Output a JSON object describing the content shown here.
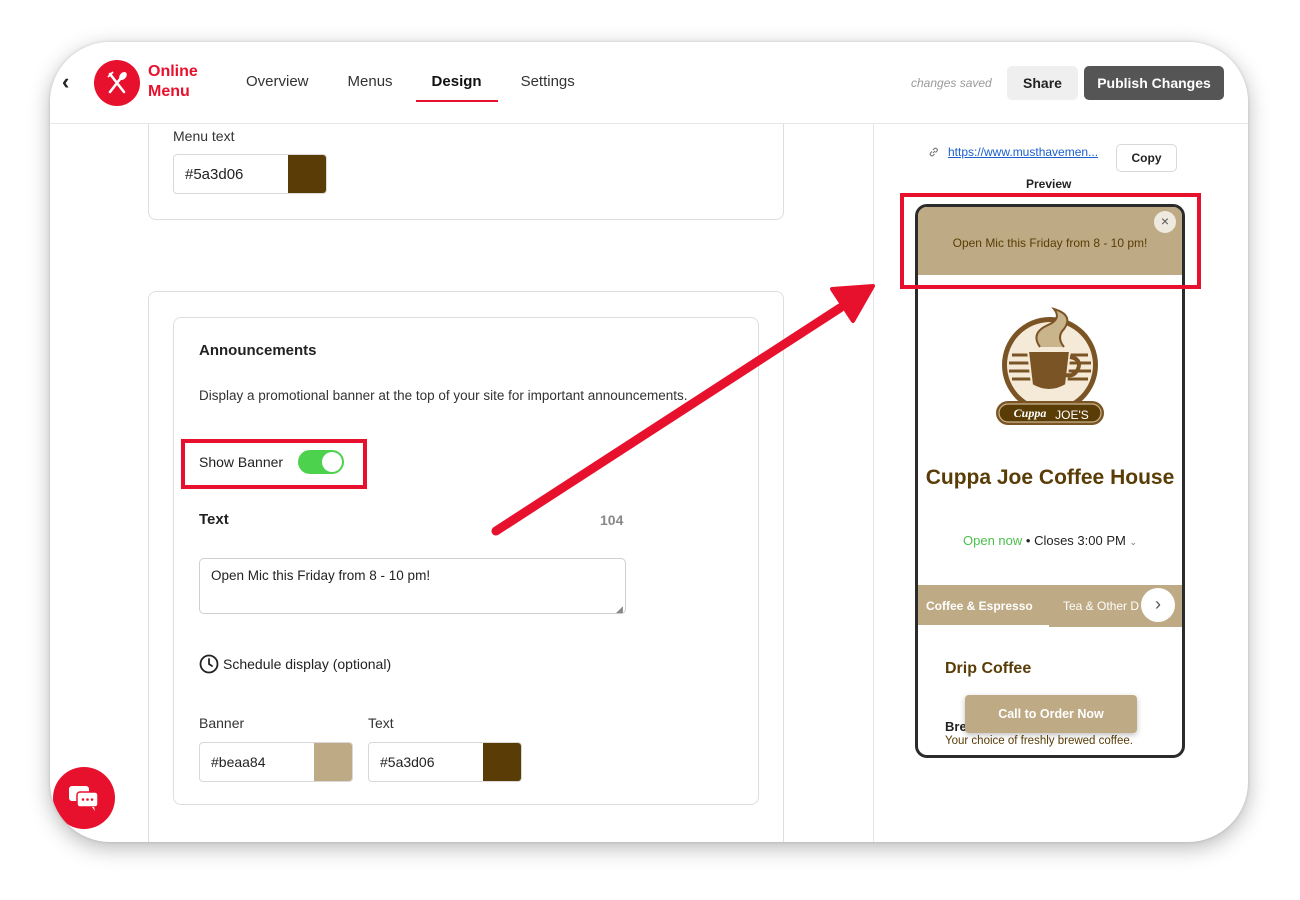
{
  "app": {
    "brand_line1": "Online",
    "brand_line2": "Menu",
    "colors": {
      "accent": "#e8112d",
      "banner": "#beaa84",
      "menu_text": "#5a3d06"
    }
  },
  "nav": {
    "items": [
      {
        "label": "Overview",
        "active": false
      },
      {
        "label": "Menus",
        "active": false
      },
      {
        "label": "Design",
        "active": true
      },
      {
        "label": "Settings",
        "active": false
      }
    ]
  },
  "header": {
    "status": "changes saved",
    "share_label": "Share",
    "publish_label": "Publish Changes"
  },
  "menu_text_section": {
    "label": "Menu text",
    "value": "#5a3d06",
    "swatch_color": "#5a3d06"
  },
  "announcements": {
    "title": "Announcements",
    "description": "Display a promotional banner at the top of your site for important announcements.",
    "show_banner_label": "Show Banner",
    "show_banner_on": true,
    "text_label": "Text",
    "char_count": "104",
    "text_value": "Open Mic this Friday from 8 - 10 pm!",
    "schedule_label": "Schedule display (optional)",
    "banner_label": "Banner",
    "banner_value": "#beaa84",
    "banner_swatch": "#beaa84",
    "text_color_label": "Text",
    "text_color_value": "#5a3d06",
    "text_color_swatch": "#5a3d06"
  },
  "preview_panel": {
    "url": "https://www.musthavemen...",
    "copy_label": "Copy",
    "preview_label": "Preview",
    "phone": {
      "banner_text": "Open Mic this Friday from 8 - 10 pm!",
      "close_glyph": "×",
      "logo_text_left": "Cuppa",
      "logo_text_right": "JOE'S",
      "restaurant_name": "Cuppa Joe Coffee House",
      "open_status": "Open now",
      "closes": "Closes 3:00 PM",
      "tab_active": "Coffee & Espresso",
      "tab_next": "Tea & Other D",
      "section_title": "Drip Coffee",
      "item_name": "Bre",
      "item_desc": "Your choice of freshly brewed coffee.",
      "call_button": "Call to Order Now"
    }
  }
}
